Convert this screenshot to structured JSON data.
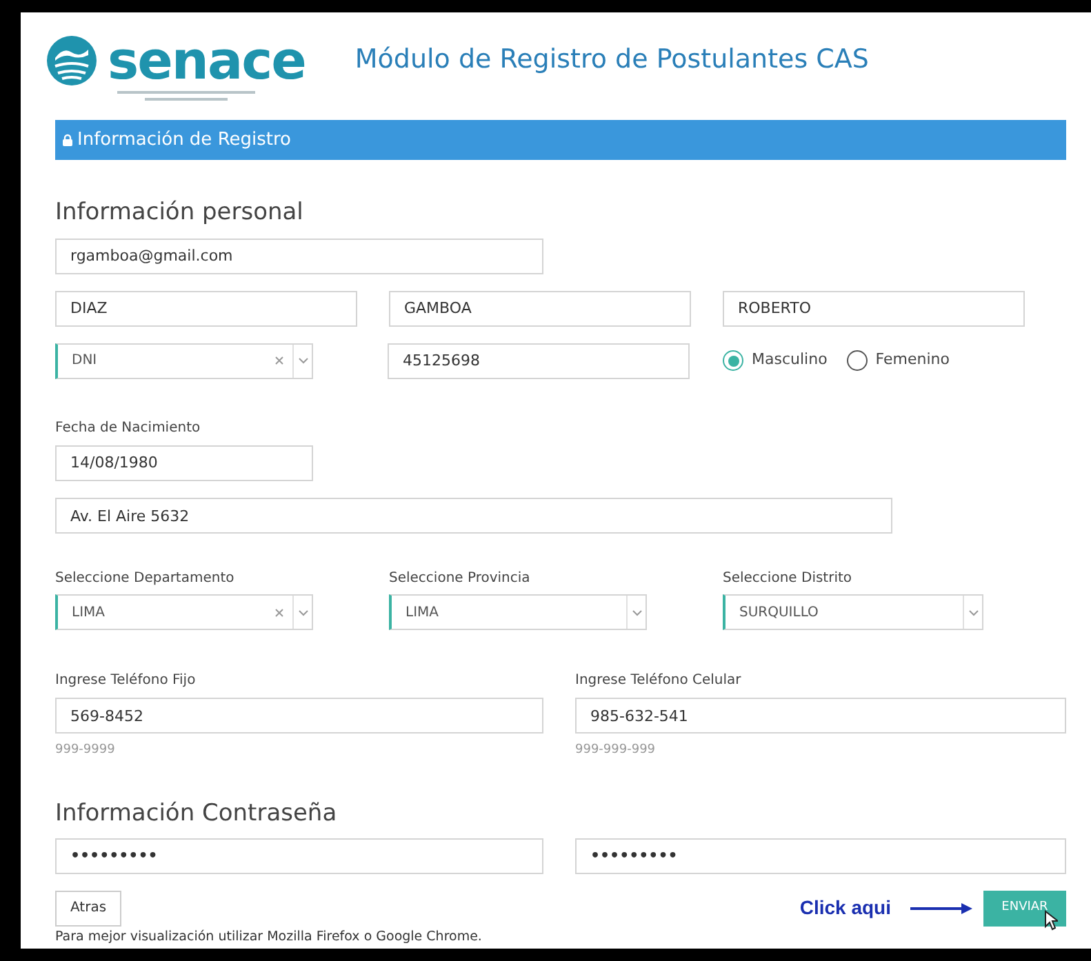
{
  "header": {
    "logo_text": "senace",
    "title": "Módulo de Registro de Postulantes CAS"
  },
  "panel": {
    "title": "Información de Registro"
  },
  "personal": {
    "heading": "Información personal",
    "email": {
      "value": "rgamboa@gmail.com"
    },
    "names": [
      {
        "value": "DIAZ"
      },
      {
        "value": "GAMBOA"
      },
      {
        "value": "ROBERTO"
      }
    ],
    "document_type": {
      "value": "DNI",
      "clearable": true
    },
    "document_number": {
      "value": "45125698"
    },
    "gender": [
      {
        "label": "Masculino",
        "selected": true
      },
      {
        "label": "Femenino",
        "selected": false
      }
    ],
    "birth_date": {
      "label": "Fecha de Nacimiento",
      "value": "14/08/1980"
    },
    "address": {
      "value": "Av. El Aire 5632"
    },
    "location": [
      {
        "label": "Seleccione Departamento",
        "value": "LIMA",
        "clearable": true
      },
      {
        "label": "Seleccione Provincia",
        "value": "LIMA",
        "clearable": false
      },
      {
        "label": "Seleccione Distrito",
        "value": "SURQUILLO",
        "clearable": false
      }
    ],
    "phones": [
      {
        "label": "Ingrese Teléfono Fijo",
        "value": "569-8452",
        "hint": "999-9999"
      },
      {
        "label": "Ingrese Teléfono Celular",
        "value": "985-632-541",
        "hint": "999-999-999"
      }
    ]
  },
  "password": {
    "heading": "Información Contraseña",
    "fields": [
      {
        "value": "•••••••••"
      },
      {
        "value": "•••••••••"
      }
    ]
  },
  "footer": {
    "back_button": "Atras",
    "note": "Para mejor visualización utilizar Mozilla Firefox o Google Chrome.",
    "callout": "Click aqui",
    "submit_button": "ENVIAR"
  }
}
